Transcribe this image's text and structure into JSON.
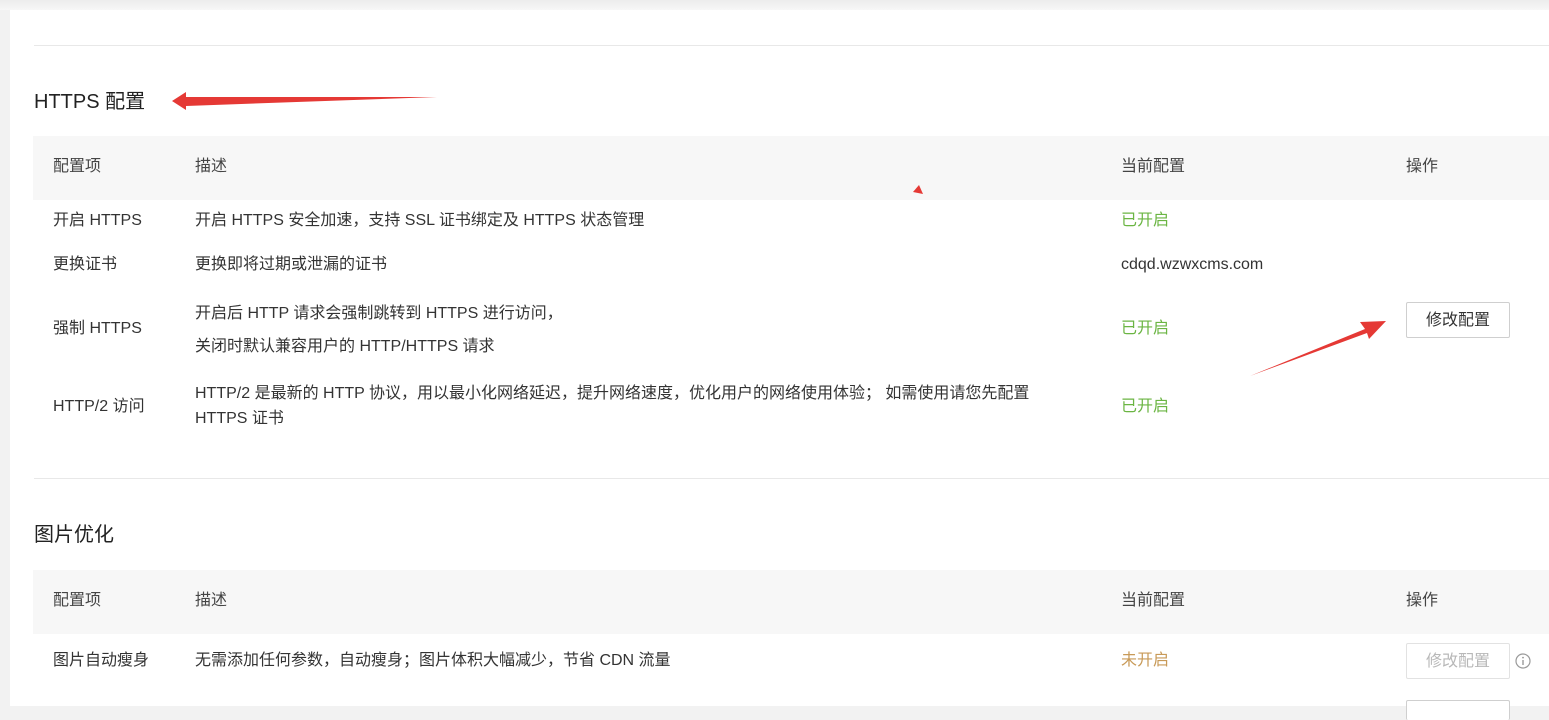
{
  "https_section": {
    "title": "HTTPS 配置",
    "headers": {
      "item": "配置项",
      "desc": "描述",
      "current": "当前配置",
      "action": "操作"
    },
    "rows": [
      {
        "name": "开启 HTTPS",
        "desc": [
          "开启 HTTPS 安全加速，支持 SSL 证书绑定及 HTTPS 状态管理"
        ],
        "value": "已开启",
        "state": "on"
      },
      {
        "name": "更换证书",
        "desc": [
          "更换即将过期或泄漏的证书"
        ],
        "value": "cdqd.wzwxcms.com",
        "state": "text"
      },
      {
        "name": "强制 HTTPS",
        "desc": [
          "开启后 HTTP 请求会强制跳转到 HTTPS 进行访问，",
          "关闭时默认兼容用户的 HTTP/HTTPS 请求"
        ],
        "value": "已开启",
        "state": "on",
        "action": "修改配置"
      },
      {
        "name": "HTTP/2 访问",
        "desc": [
          "HTTP/2 是最新的 HTTP 协议，用以最小化网络延迟，提升网络速度，优化用户的网络使用体验； 如需使用请您先配置",
          "HTTPS 证书"
        ],
        "value": "已开启",
        "state": "on"
      }
    ]
  },
  "image_section": {
    "title": "图片优化",
    "headers": {
      "item": "配置项",
      "desc": "描述",
      "current": "当前配置",
      "action": "操作"
    },
    "rows": [
      {
        "name": "图片自动瘦身",
        "desc": [
          "无需添加任何参数，自动瘦身；图片体积大幅减少，节省 CDN 流量"
        ],
        "value": "未开启",
        "state": "off",
        "action": "修改配置",
        "action_disabled": true
      }
    ]
  },
  "colors": {
    "enabled": "#6bb543",
    "disabled": "#c89a58",
    "annotation": "#e53935"
  },
  "icons": {
    "info": "info-circle-icon",
    "annotation": "red-arrow-icon"
  }
}
